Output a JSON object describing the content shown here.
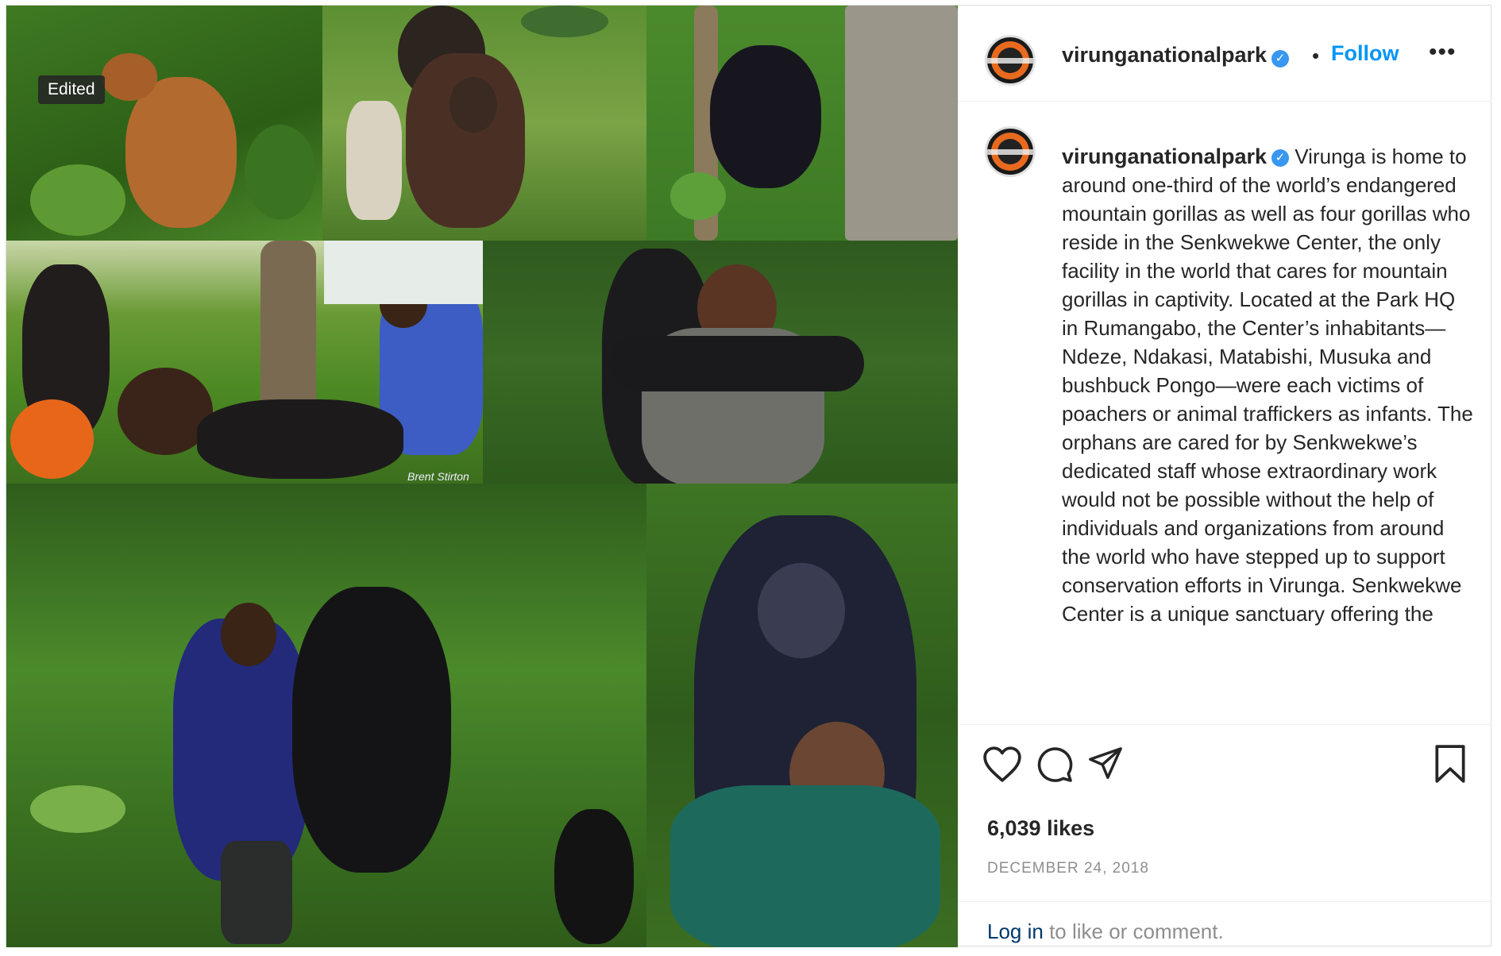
{
  "media": {
    "badge": "Edited",
    "photo_credit": "Brent Stirton"
  },
  "header": {
    "username": "virunganationalpark",
    "separator": "•",
    "follow_label": "Follow",
    "more_label": "•••"
  },
  "caption": {
    "username": "virunganationalpark",
    "text": "Virunga is home to around one-third of the world’s endangered mountain gorillas as well as four gorillas who reside in the Senkwekwe Center, the only facility in the world that cares for mountain gorillas in captivity. Located at the Park HQ in Rumangabo, the Center’s inhabitants—Ndeze, Ndakasi, Matabishi, Musuka and bushbuck Pongo—were each victims of poachers or animal traffickers as infants. The orphans are cared for by Senkwekwe’s dedicated staff whose extraordinary work would not be possible without the help of individuals and organizations from around the world who have stepped up to support conservation efforts in Virunga.  Senkwekwe Center is a unique sanctuary offering the"
  },
  "actions": {
    "like_icon": "heart-icon",
    "comment_icon": "comment-bubble-icon",
    "share_icon": "paper-plane-icon",
    "save_icon": "bookmark-icon",
    "likes": "6,039 likes",
    "date": "DECEMBER 24, 2018"
  },
  "login": {
    "link": "Log in",
    "rest": " to like or comment."
  },
  "colors": {
    "link_blue": "#0095f6",
    "verified_blue": "#3897f0",
    "text": "#262626",
    "muted": "#8e8e8e"
  }
}
